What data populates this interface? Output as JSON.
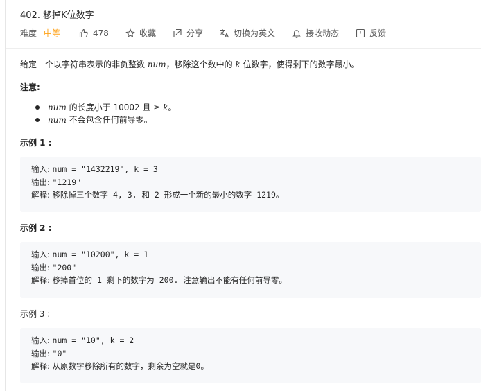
{
  "problem": {
    "title": "402. 移掉K位数字",
    "difficulty_label": "难度",
    "difficulty": "中等",
    "likes": "478",
    "favorite_label": "收藏",
    "share_label": "分享",
    "switch_lang_label": "切换为英文",
    "notify_label": "接收动态",
    "feedback_label": "反馈",
    "accent_color": "#ffa116"
  },
  "description": {
    "part1": "给定一个以字符串表示的非负整数 ",
    "var_num": "num",
    "part2": "，移除这个数中的 ",
    "var_k": "k",
    "part3": " 位数字，使得剩下的数字最小。"
  },
  "note": {
    "label": "注意:",
    "items": [
      {
        "var": "num",
        "text": " 的长度小于 10002 且 ≥ ",
        "var2": "k",
        "tail": "。"
      },
      {
        "var": "num",
        "text": " 不会包含任何前导零。"
      }
    ]
  },
  "examples": [
    {
      "label": "示例 1 :",
      "input_label": "输入: ",
      "input": "num = \"1432219\", k = 3",
      "output_label": "输出: ",
      "output": "\"1219\"",
      "explain_label": "解释: ",
      "explain": "移除掉三个数字 4, 3, 和 2 形成一个新的最小的数字 1219。"
    },
    {
      "label": "示例 2 :",
      "input_label": "输入: ",
      "input": "num = \"10200\", k = 1",
      "output_label": "输出: ",
      "output": "\"200\"",
      "explain_label": "解释: ",
      "explain": "移掉首位的 1 剩下的数字为 200. 注意输出不能有任何前导零。"
    },
    {
      "label": "示例 3 :",
      "input_label": "输入: ",
      "input": "num = \"10\", k = 2",
      "output_label": "输出: ",
      "output": "\"0\"",
      "explain_label": "解释: ",
      "explain": "从原数字移除所有的数字，剩余为空就是0。"
    }
  ]
}
